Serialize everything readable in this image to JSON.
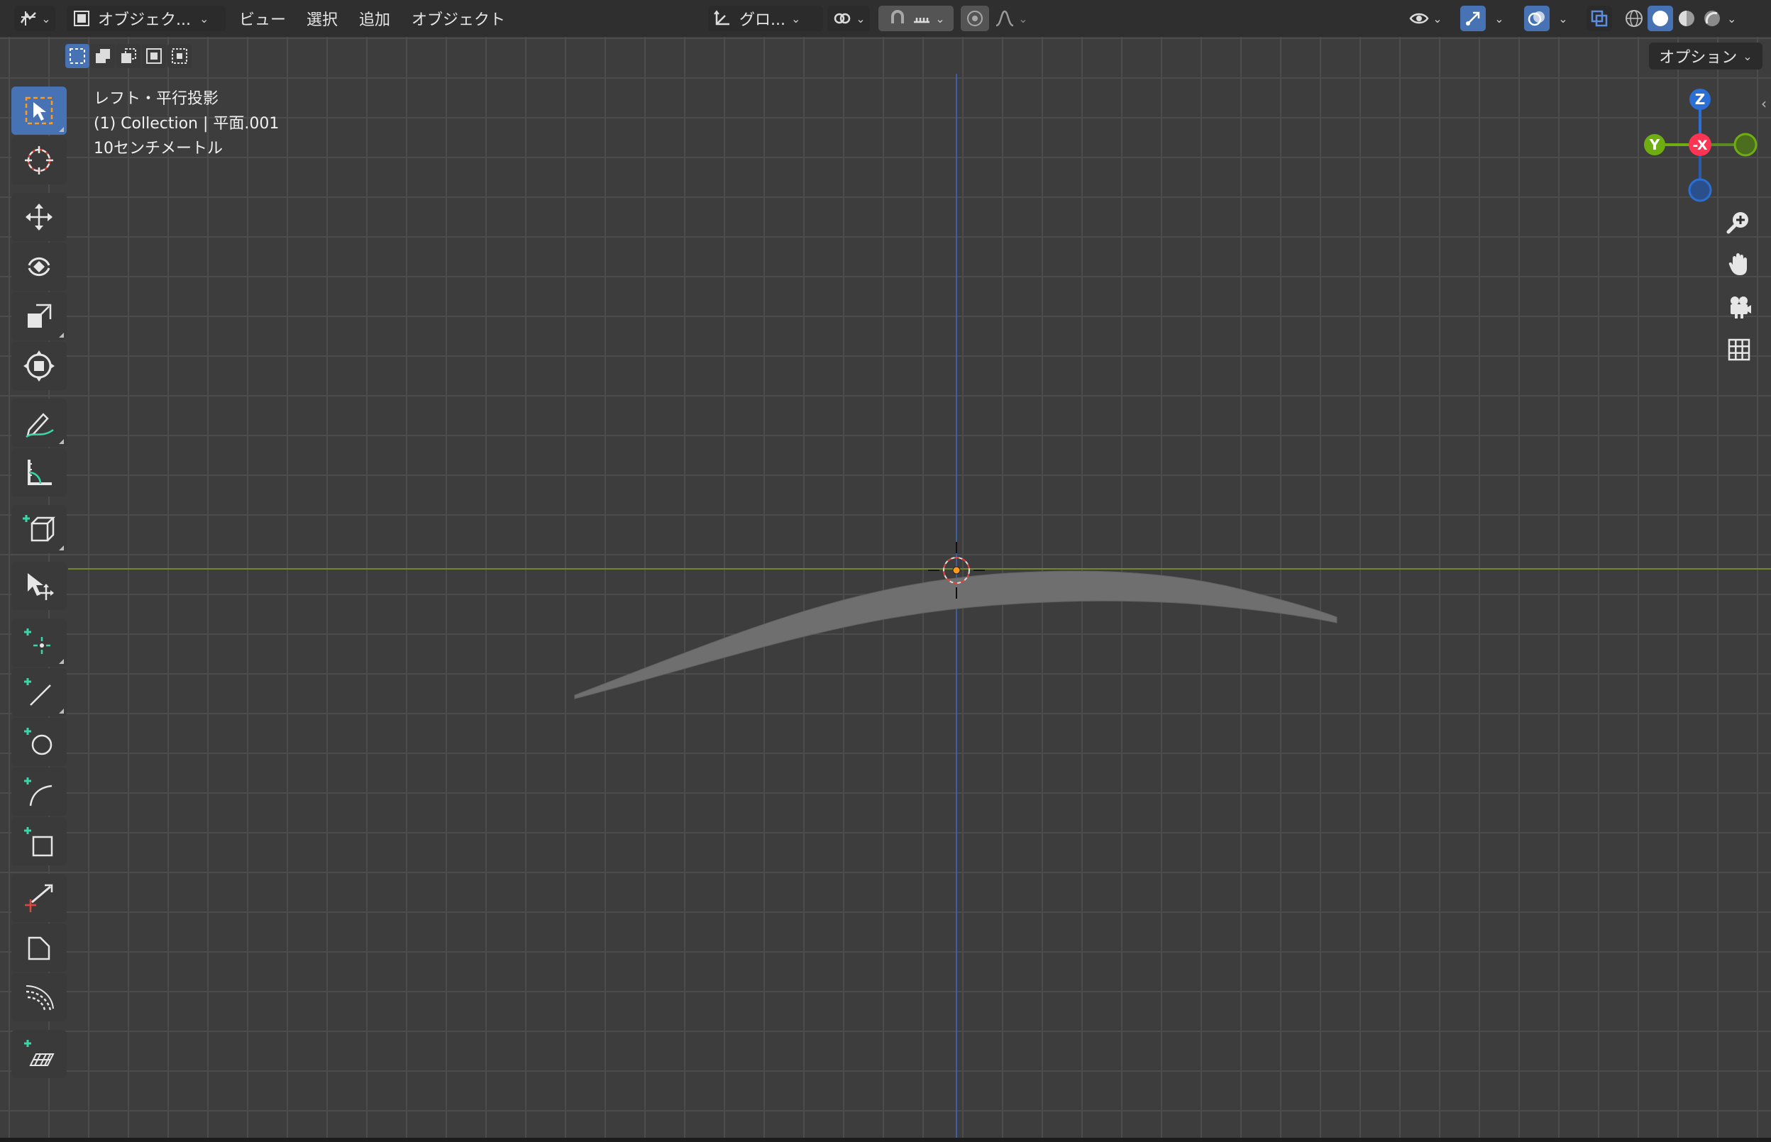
{
  "header": {
    "editor_type_icon": "editor-type-icon",
    "mode_label": "オブジェク...",
    "menus": [
      "ビュー",
      "選択",
      "追加",
      "オブジェクト"
    ],
    "orientation_label": "グロ...",
    "options_label": "オプション"
  },
  "viewport": {
    "view_name": "レフト・平行投影",
    "collection_info": "(1) Collection | 平面.001",
    "scale_info": "10センチメートル"
  },
  "gizmo": {
    "z_label": "Z",
    "y_label": "Y",
    "x_label": "-X"
  },
  "colors": {
    "accent": "#4772b3",
    "x_axis": "#ff3352",
    "y_axis": "#8bdc00",
    "z_axis": "#2890ff",
    "y_axis_line": "#6e8a2c",
    "z_axis_line": "#3a5fa8",
    "mesh": "#6f6f6f",
    "grid_bg": "#3d3d3d"
  },
  "toolbar": {
    "tools": [
      "select-box-icon",
      "cursor-icon",
      "move-icon",
      "rotate-icon",
      "scale-icon",
      "transform-icon",
      "annotate-icon",
      "measure-icon",
      "add-cube-icon",
      "move-tool-icon",
      "add-vertex-icon",
      "add-line-icon",
      "add-circle-icon",
      "add-arc-icon",
      "add-rectangle-icon",
      "knife-icon",
      "bevel-icon",
      "spin-icon",
      "add-grid-icon"
    ]
  }
}
